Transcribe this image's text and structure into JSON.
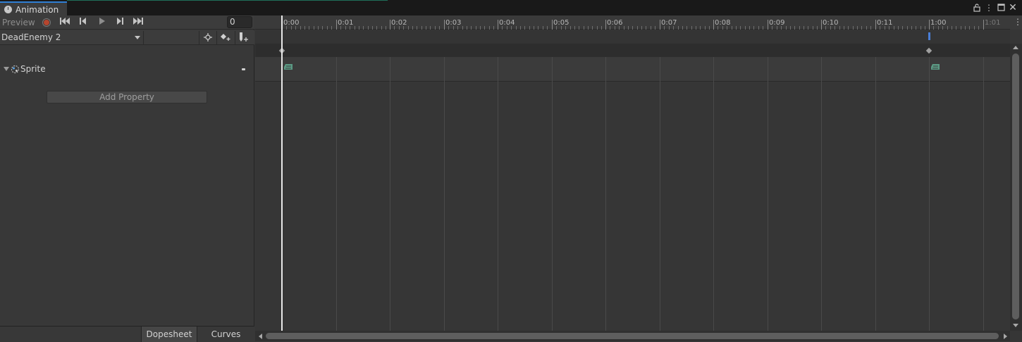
{
  "window": {
    "tab_title": "Animation",
    "lock_icon": "lock-icon",
    "menu_icon": "kebab-menu-icon",
    "maximize_icon": "maximize-icon",
    "close_icon": "close-icon"
  },
  "toolbar": {
    "preview_label": "Preview",
    "record_icon": "record-icon",
    "first_key_icon": "skip-to-start-icon",
    "prev_key_icon": "previous-keyframe-icon",
    "play_icon": "play-icon",
    "next_key_icon": "next-keyframe-icon",
    "last_key_icon": "skip-to-end-icon",
    "frame_value": "0"
  },
  "clip": {
    "selected": "DeadEnemy 2",
    "filter_icon": "crosshair-icon",
    "add_keyframe_icon": "add-keyframe-icon",
    "add_event_icon": "add-event-icon"
  },
  "properties": [
    {
      "label": "Sprite",
      "icon": "sprite-renderer-icon"
    }
  ],
  "add_property_label": "Add Property",
  "bottom_tabs": {
    "dopesheet": "Dopesheet",
    "curves": "Curves"
  },
  "timeline": {
    "labels": [
      "0:00",
      "0:01",
      "0:02",
      "0:03",
      "0:04",
      "0:05",
      "0:06",
      "0:07",
      "0:08",
      "0:09",
      "0:10",
      "0:11",
      "1:00",
      "1:01"
    ],
    "keyframe_times": [
      "0:00",
      "1:00"
    ],
    "event_time": "1:00"
  },
  "colors": {
    "accent": "#2f7fd5",
    "record": "#b5452e",
    "event_marker": "#4a7fd8",
    "keyframe": "#5b9a84"
  }
}
